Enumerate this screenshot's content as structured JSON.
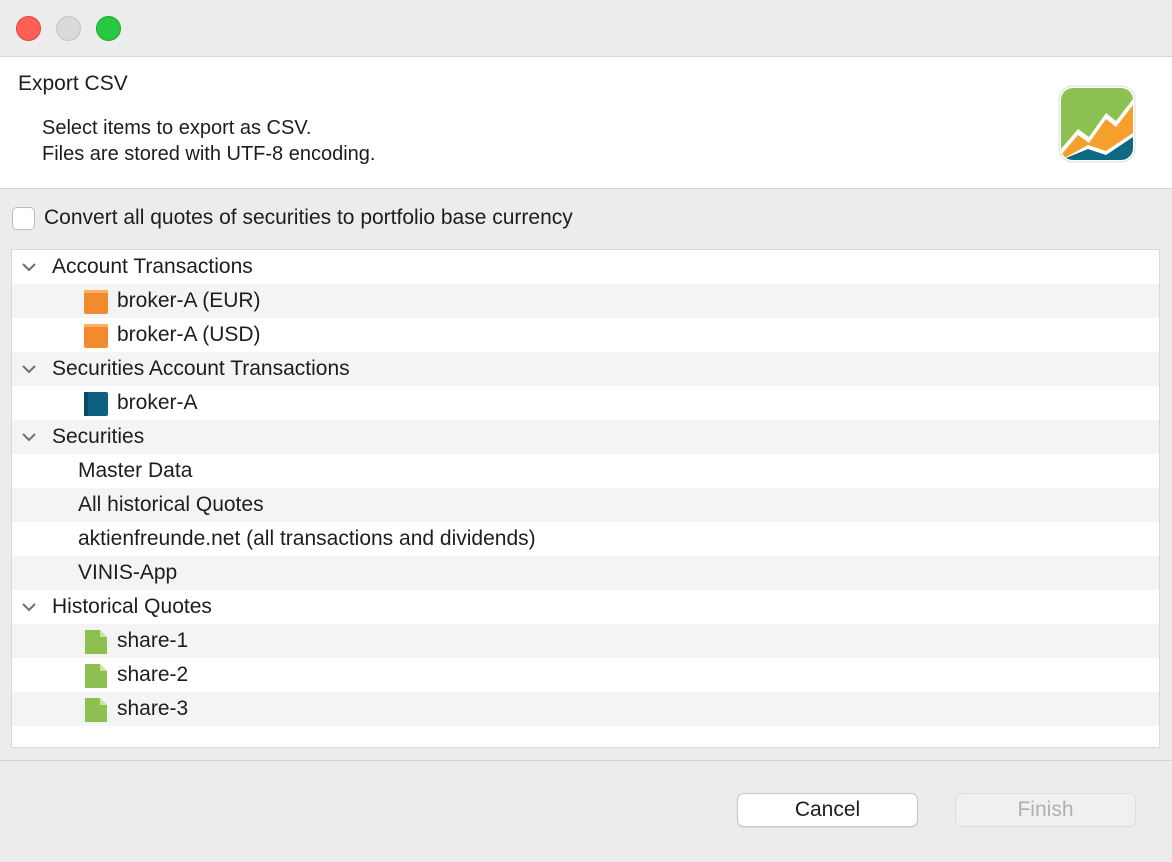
{
  "window": {
    "title": ""
  },
  "header": {
    "title": "Export CSV",
    "message_line1": "Select items to export as CSV.",
    "message_line2": "Files are stored with UTF-8 encoding."
  },
  "convert_option": {
    "label": "Convert all quotes of securities to portfolio base currency",
    "checked": false
  },
  "tree": {
    "groups": [
      {
        "label": "Account Transactions",
        "expanded": true,
        "items": [
          {
            "label": "broker-A (EUR)",
            "icon": "account-icon"
          },
          {
            "label": "broker-A (USD)",
            "icon": "account-icon"
          }
        ]
      },
      {
        "label": "Securities Account Transactions",
        "expanded": true,
        "items": [
          {
            "label": "broker-A",
            "icon": "portfolio-icon"
          }
        ]
      },
      {
        "label": "Securities",
        "expanded": true,
        "items": [
          {
            "label": "Master Data"
          },
          {
            "label": "All historical Quotes"
          },
          {
            "label": "aktienfreunde.net (all transactions and dividends)"
          },
          {
            "label": "VINIS-App"
          }
        ]
      },
      {
        "label": "Historical Quotes",
        "expanded": true,
        "items": [
          {
            "label": "share-1",
            "icon": "security-icon"
          },
          {
            "label": "share-2",
            "icon": "security-icon"
          },
          {
            "label": "share-3",
            "icon": "security-icon"
          }
        ]
      }
    ]
  },
  "buttons": {
    "cancel": "Cancel",
    "finish": "Finish"
  },
  "colors": {
    "account": "#f28a2e",
    "portfolio": "#0e6080",
    "security": "#8cc152",
    "logo_green": "#8cc152",
    "logo_orange": "#f5a02c",
    "logo_teal": "#0e6a83"
  }
}
